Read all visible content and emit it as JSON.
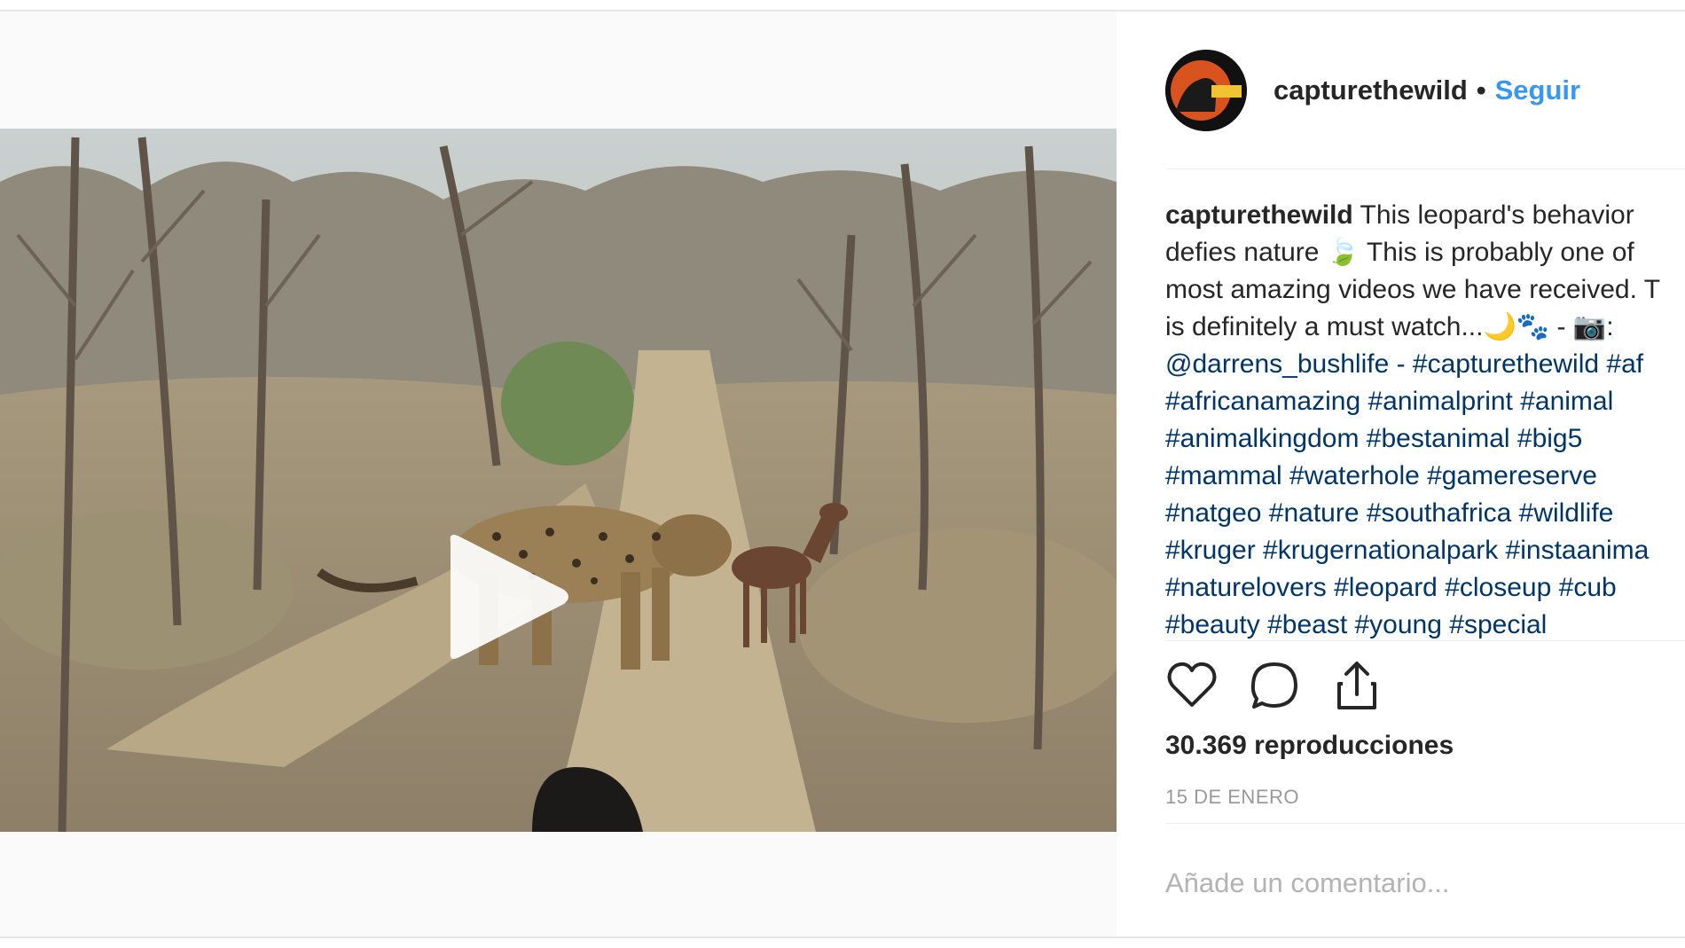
{
  "post": {
    "username": "capturethewild",
    "separator": "•",
    "follow_label": "Seguir",
    "caption": {
      "username": "capturethewild",
      "lines": [
        " This leopard's behavior",
        "defies nature 🍃 This is probably one of",
        "most amazing videos we have received. T",
        "is definitely a must watch...🌙🐾 - 📷:"
      ],
      "tag_lines": [
        "@darrens_bushlife - #capturethewild #af",
        "#africanamazing #animalprint #animal",
        "#animalkingdom #bestanimal #big5",
        "#mammal #waterhole #gamereserve",
        "#natgeo #nature #southafrica #wildlife",
        "#kruger #krugernationalpark #instaanima",
        "#naturelovers #leopard #closeup #cub",
        "#beauty #beast #young #special"
      ]
    },
    "views": "30.369 reproducciones",
    "date": "15 DE ENERO",
    "comment_placeholder": "Añade un comentario..."
  },
  "icons": {
    "like": "heart-icon",
    "comment": "comment-bubble-icon",
    "share": "share-icon",
    "play": "play-icon"
  },
  "colors": {
    "link_blue": "#3897f0",
    "hashtag": "#003569",
    "text": "#262626",
    "muted": "#999999",
    "panel_bg": "#fafafa"
  }
}
